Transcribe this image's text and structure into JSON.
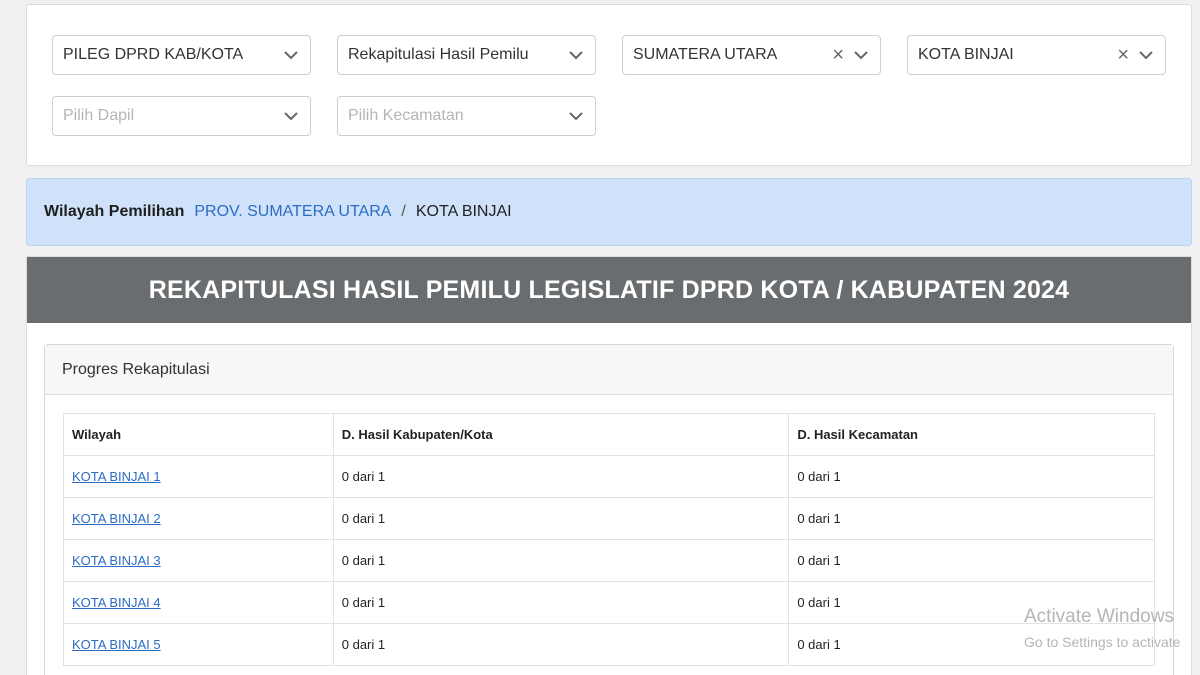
{
  "filters": {
    "election_type": "PILEG DPRD KAB/KOTA",
    "report_type": "Rekapitulasi Hasil Pemilu",
    "province": "SUMATERA UTARA",
    "city": "KOTA BINJAI",
    "dapil_placeholder": "Pilih Dapil",
    "kecamatan_placeholder": "Pilih Kecamatan",
    "clear_glyph": "×"
  },
  "region": {
    "label": "Wilayah Pemilihan",
    "crumb_province": "PROV. SUMATERA UTARA",
    "separator": "/",
    "crumb_city": "KOTA BINJAI"
  },
  "main": {
    "title": "REKAPITULASI HASIL PEMILU LEGISLATIF DPRD KOTA / KABUPATEN 2024"
  },
  "progress": {
    "title": "Progres Rekapitulasi",
    "columns": [
      "Wilayah",
      "D. Hasil Kabupaten/Kota",
      "D. Hasil Kecamatan"
    ],
    "rows": [
      {
        "wilayah": "KOTA BINJAI 1",
        "kabkota": "0 dari 1",
        "kecamatan": "0 dari 1"
      },
      {
        "wilayah": "KOTA BINJAI 2",
        "kabkota": "0 dari 1",
        "kecamatan": "0 dari 1"
      },
      {
        "wilayah": "KOTA BINJAI 3",
        "kabkota": "0 dari 1",
        "kecamatan": "0 dari 1"
      },
      {
        "wilayah": "KOTA BINJAI 4",
        "kabkota": "0 dari 1",
        "kecamatan": "0 dari 1"
      },
      {
        "wilayah": "KOTA BINJAI 5",
        "kabkota": "0 dari 1",
        "kecamatan": "0 dari 1"
      }
    ]
  },
  "watermark": {
    "line1": "Activate Windows",
    "line2": "Go to Settings to activate"
  },
  "colors": {
    "header_bg": "#6a6d70",
    "region_bg": "#cfe2fa",
    "link": "#2b6cc4"
  },
  "icons": {
    "dropdown": "chevron-down-icon",
    "clear": "clear-x-icon"
  }
}
